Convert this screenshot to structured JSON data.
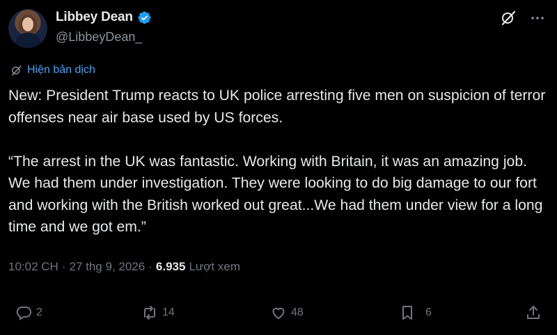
{
  "author": {
    "display_name": "Libbey Dean",
    "handle": "@LibbeyDean_",
    "verified": true
  },
  "translate_label": "Hiện bản dịch",
  "tweet_text": "New: President Trump reacts to UK police arresting five men on suspicion of terror offenses near air base used by US forces.\n\n“The arrest in the UK was fantastic. Working with Britain, it was an amazing job. We had them under investigation. They were looking to do big damage to our fort and working with the British worked out great...We had them under view for a long time and we got em.”",
  "meta": {
    "time": "10:02 CH",
    "separator": "·",
    "date": "27 thg 9, 2026",
    "views_count": "6.935",
    "views_label": "Lượt xem"
  },
  "actions": {
    "replies": "2",
    "reposts": "14",
    "likes": "48",
    "bookmarks": "6"
  },
  "colors": {
    "background": "#000000",
    "text": "#e7e9ea",
    "secondary": "#71767b",
    "link": "#4ea3f1",
    "verified": "#1d9bf0"
  }
}
